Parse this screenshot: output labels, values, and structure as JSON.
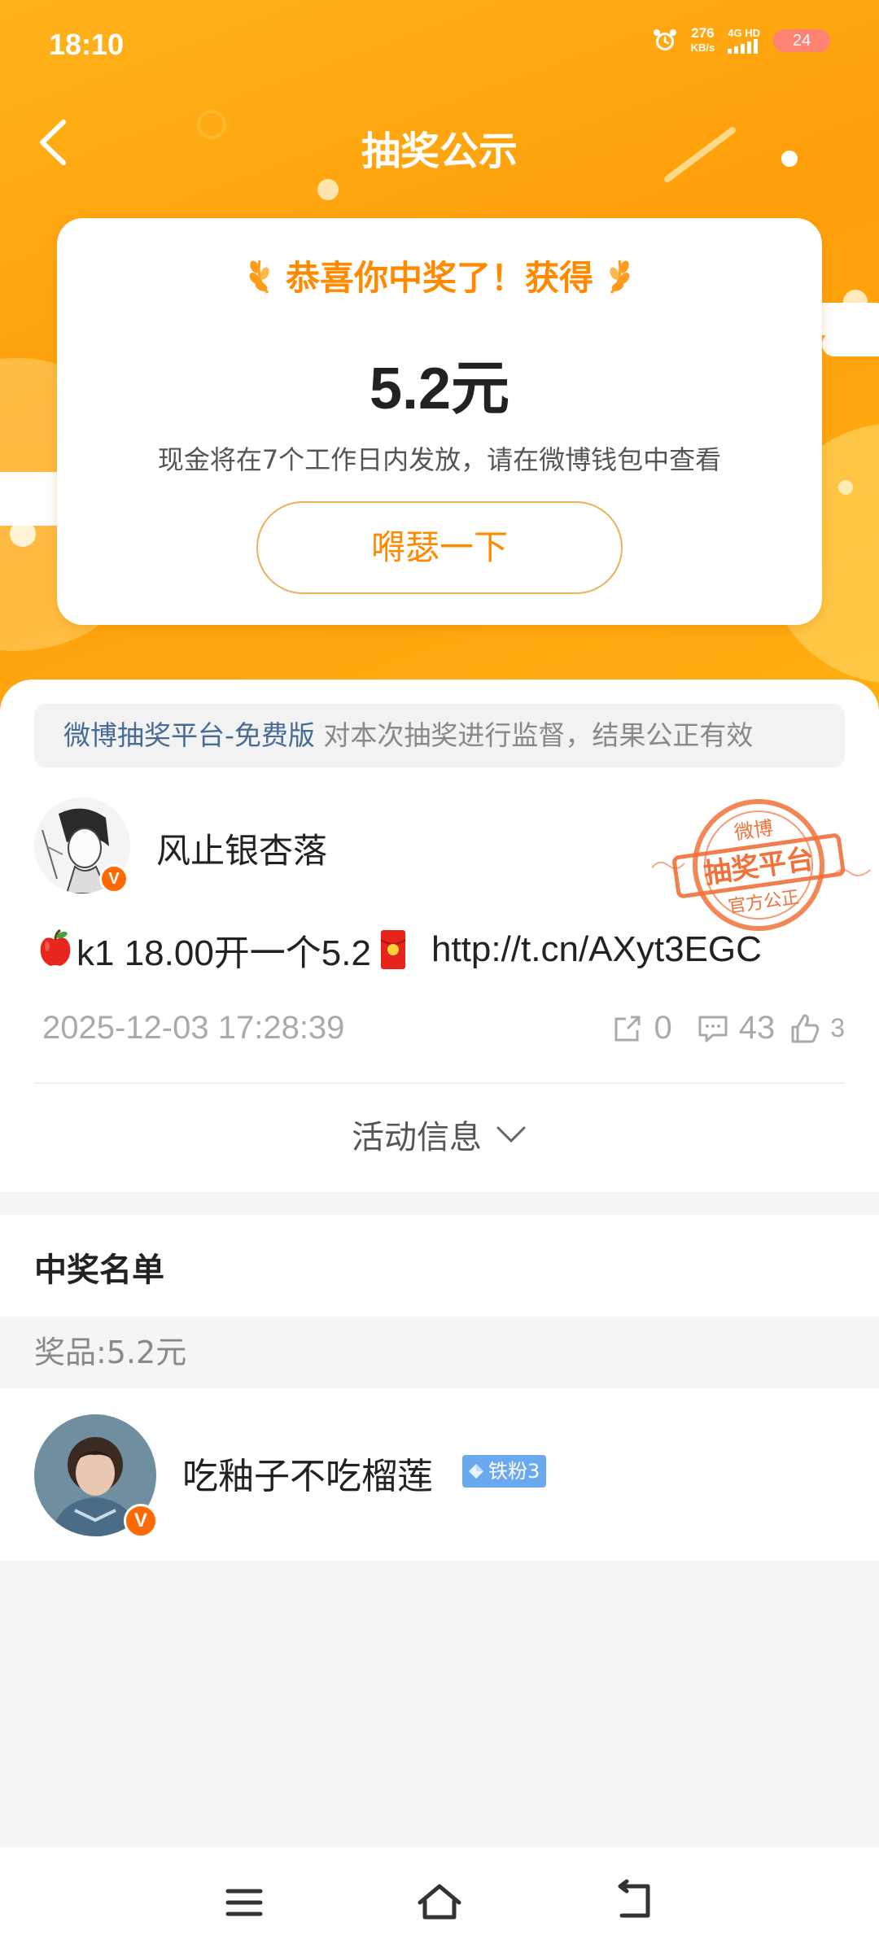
{
  "status_bar": {
    "time": "18:10",
    "net_speed_value": "276",
    "net_speed_unit": "KB/s",
    "network": "4G HD",
    "battery": "24"
  },
  "header": {
    "title": "抽奖公示"
  },
  "win_card": {
    "congrats": "恭喜你中奖了！获得",
    "amount": "5.2元",
    "notice": "现金将在7个工作日内发放，请在微博钱包中查看",
    "brag_button": "嘚瑟一下"
  },
  "supervise": {
    "platform_link": "微博抽奖平台-免费版",
    "text": " 对本次抽奖进行监督，结果公正有效"
  },
  "author": {
    "name": "风止银杏落",
    "verified": "V"
  },
  "stamp": {
    "top": "微博",
    "middle": "抽奖平台",
    "bottom": "官方公正"
  },
  "post": {
    "text": "k1 18.00开一个5.2",
    "url": "http://t.cn/AXyt3EGC",
    "time": "2025-12-03 17:28:39",
    "reposts": "0",
    "comments": "43",
    "likes": "3"
  },
  "activity": {
    "label": "活动信息"
  },
  "winners": {
    "title": "中奖名单",
    "prize": "奖品:5.2元",
    "list": [
      {
        "name": "吃釉子不吃榴莲",
        "verified": "V",
        "badge": "铁粉3"
      }
    ]
  },
  "colors": {
    "accent": "#ff8a00",
    "hero_start": "#ffb21a",
    "hero_end": "#ff9f0a",
    "link": "#466c96",
    "fan_badge": "#6aa8ef"
  },
  "icons": [
    "alarm-icon",
    "back-arrow-icon",
    "wheat-left-icon",
    "wheat-right-icon",
    "apple-icon",
    "red-packet-icon",
    "repost-icon",
    "comment-icon",
    "like-icon",
    "chevron-down-icon",
    "menu-icon",
    "home-icon",
    "back-icon"
  ]
}
